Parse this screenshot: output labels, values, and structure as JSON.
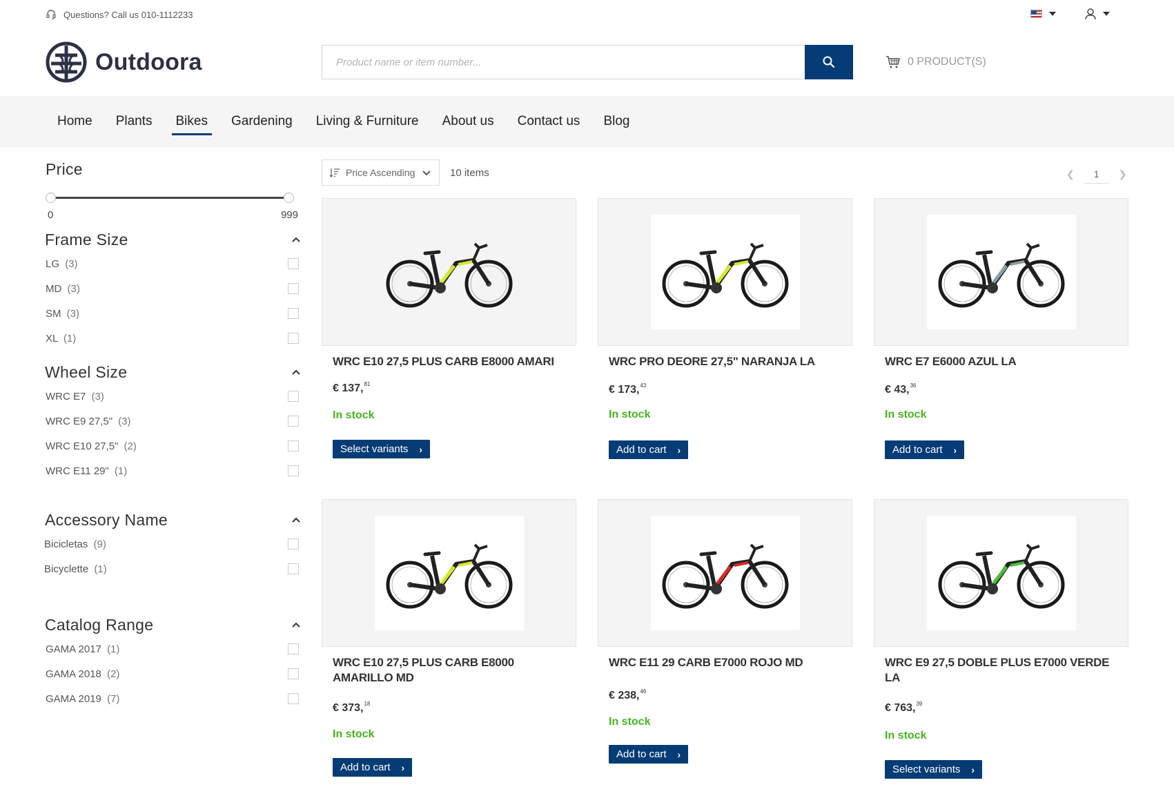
{
  "topbar": {
    "phone_text": "Questions? Call us 010-1112233",
    "headset_icon": "headset-icon",
    "flag_icon": "us-flag-icon",
    "user_icon": "user-icon"
  },
  "header": {
    "logo_text": "Outdoora",
    "search_placeholder": "Product name or item number...",
    "cart_label": "0 PRODUCT(S)"
  },
  "nav": {
    "items": [
      "Home",
      "Plants",
      "Bikes",
      "Gardening",
      "Living & Furniture",
      "About us",
      "Contact us",
      "Blog"
    ],
    "active": "Bikes"
  },
  "filters": {
    "price": {
      "title": "Price",
      "min": "0",
      "max": "999"
    },
    "frame_size": {
      "title": "Frame Size",
      "options": [
        {
          "label": "LG",
          "count": "(3)"
        },
        {
          "label": "MD",
          "count": "(3)"
        },
        {
          "label": "SM",
          "count": "(3)"
        },
        {
          "label": "XL",
          "count": "(1)"
        }
      ]
    },
    "wheel_size": {
      "title": "Wheel Size",
      "options": [
        {
          "label": "WRC E7",
          "count": "(3)"
        },
        {
          "label": "WRC E9 27,5\"",
          "count": "(3)"
        },
        {
          "label": "WRC E10 27,5\"",
          "count": "(2)"
        },
        {
          "label": "WRC E11 29\"",
          "count": "(1)"
        }
      ]
    },
    "accessory_name": {
      "title": "Accessory Name",
      "options": [
        {
          "label": "Bicicletas",
          "count": "(9)"
        },
        {
          "label": "Bicyclette",
          "count": "(1)"
        }
      ]
    },
    "catalog_range": {
      "title": "Catalog Range",
      "options": [
        {
          "label": "GAMA 2017",
          "count": "(1)"
        },
        {
          "label": "GAMA 2018",
          "count": "(2)"
        },
        {
          "label": "GAMA 2019",
          "count": "(7)"
        }
      ]
    }
  },
  "toolbar": {
    "sort_label": "Price Ascending",
    "items_count": "10 items",
    "page": "1"
  },
  "products": [
    {
      "name": "WRC E10 27,5 PLUS CARB E8000 AMARI",
      "price": "€ 137,",
      "cents": "81",
      "stock": "In stock",
      "button": "Select variants",
      "accent": "#d8e82a"
    },
    {
      "name": "WRC PRO DEORE 27,5\" NARANJA LA",
      "price": "€ 173,",
      "cents": "43",
      "stock": "In stock",
      "button": "Add to cart",
      "accent": "#d8e82a"
    },
    {
      "name": "WRC E7 E6000 AZUL LA",
      "price": "€ 43,",
      "cents": "36",
      "stock": "In stock",
      "button": "Add to cart",
      "accent": "#8aa0a8"
    },
    {
      "name": "WRC E10 27,5 PLUS CARB E8000 AMARILLO MD",
      "price": "€ 373,",
      "cents": "18",
      "stock": "In stock",
      "button": "Add to cart",
      "accent": "#d8e82a"
    },
    {
      "name": "WRC E11 29 CARB E7000 ROJO MD",
      "price": "€ 238,",
      "cents": "46",
      "stock": "In stock",
      "button": "Add to cart",
      "accent": "#d42a2a"
    },
    {
      "name": "WRC E9 27,5 DOBLE PLUS E7000 VERDE LA",
      "price": "€ 763,",
      "cents": "39",
      "stock": "In stock",
      "button": "Select variants",
      "accent": "#4bbf3a"
    }
  ]
}
